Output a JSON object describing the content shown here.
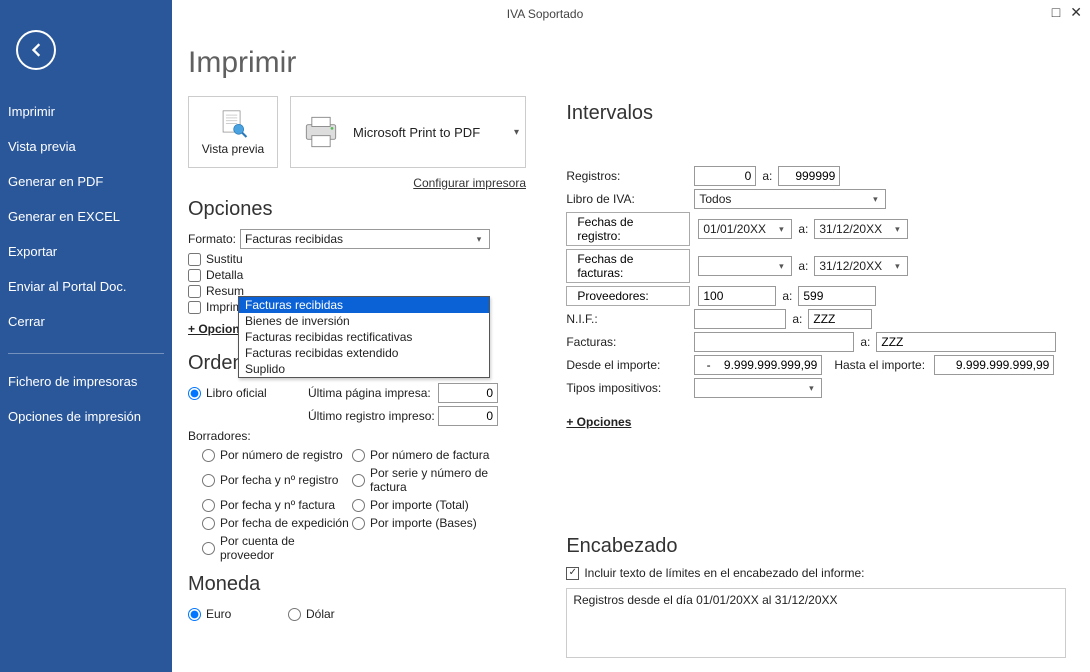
{
  "window": {
    "title": "IVA Soportado"
  },
  "sidebar": {
    "items": [
      "Imprimir",
      "Vista previa",
      "Generar en PDF",
      "Generar en EXCEL",
      "Exportar",
      "Enviar al Portal Doc.",
      "Cerrar"
    ],
    "items2": [
      "Fichero de impresoras",
      "Opciones de impresión"
    ]
  },
  "page": {
    "title": "Imprimir",
    "vista_previa": "Vista previa",
    "printer_name": "Microsoft Print to PDF",
    "config_link": "Configurar impresora"
  },
  "opciones": {
    "heading": "Opciones",
    "formato_label": "Formato:",
    "formato_value": "Facturas recibidas",
    "formato_options": [
      "Facturas recibidas",
      "Bienes de inversión",
      "Facturas recibidas rectificativas",
      "Facturas recibidas extendido",
      "Suplido"
    ],
    "check1": "Sustitu",
    "check2": "Detalla",
    "check3": "Resum",
    "check4": "Imprimir en orden inverso",
    "more": "+ Opciones"
  },
  "ordenacion": {
    "heading": "Ordenación",
    "libro_oficial": "Libro oficial",
    "ult_pagina": "Última página impresa:",
    "ult_registro": "Último registro impreso:",
    "ult_pagina_val": "0",
    "ult_registro_val": "0",
    "borradores": "Borradores:",
    "r1": "Por número de registro",
    "r2": "Por número de factura",
    "r3": "Por fecha y nº registro",
    "r4": "Por serie y número de factura",
    "r5": "Por fecha y nº factura",
    "r6": "Por importe (Total)",
    "r7": "Por fecha de expedición",
    "r8": "Por importe (Bases)",
    "r9": "Por cuenta de proveedor"
  },
  "moneda": {
    "heading": "Moneda",
    "euro": "Euro",
    "dolar": "Dólar"
  },
  "intervalos": {
    "heading": "Intervalos",
    "registros": "Registros:",
    "registros_from": "0",
    "registros_to": "999999",
    "libro_iva": "Libro de IVA:",
    "libro_iva_val": "Todos",
    "fechas_registro_btn": "Fechas de registro:",
    "fechas_registro_from": "01/01/20XX",
    "fechas_registro_to": "31/12/20XX",
    "fechas_facturas_btn": "Fechas de facturas:",
    "fechas_facturas_from": "",
    "fechas_facturas_to": "31/12/20XX",
    "proveedores_btn": "Proveedores:",
    "prov_from": "100",
    "prov_to": "599",
    "nif": "N.I.F.:",
    "nif_from": "",
    "nif_to": "ZZZ",
    "facturas": "Facturas:",
    "facturas_from": "",
    "facturas_to": "ZZZ",
    "desde_importe": "Desde el importe:",
    "desde_importe_val": "-    9.999.999.999,99",
    "hasta_importe": "Hasta el importe:",
    "hasta_importe_val": "9.999.999.999,99",
    "tipos_imp": "Tipos impositivos:",
    "tipos_imp_val": "",
    "more": "+ Opciones",
    "a": "a:"
  },
  "encabezado": {
    "heading": "Encabezado",
    "check": "Incluir texto de límites en el encabezado del informe:",
    "text": "Registros desde el día 01/01/20XX al 31/12/20XX"
  }
}
